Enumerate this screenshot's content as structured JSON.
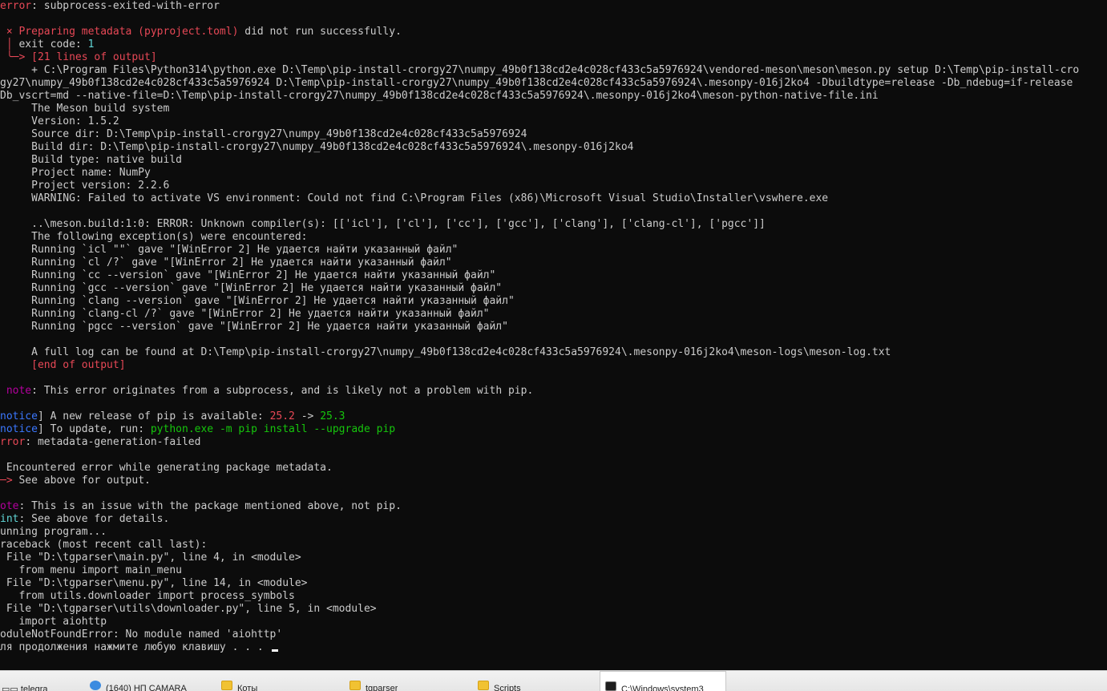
{
  "terminal": {
    "lines": [
      [
        {
          "t": "error",
          "c": "red"
        },
        {
          "t": ": subprocess-exited-with-error",
          "c": "gray"
        }
      ],
      [],
      [
        {
          "t": " × Preparing metadata (pyproject.toml)",
          "c": "red"
        },
        {
          "t": " did not run successfully.",
          "c": "gray"
        }
      ],
      [
        {
          "t": " │",
          "c": "red"
        },
        {
          "t": " exit code: ",
          "c": "gray"
        },
        {
          "t": "1",
          "c": "cyan"
        }
      ],
      [
        {
          "t": " ╰─> [21 lines of output]",
          "c": "red"
        }
      ],
      [
        {
          "t": "     + C:\\Program Files\\Python314\\python.exe D:\\Temp\\pip-install-crorgy27\\numpy_49b0f138cd2e4c028cf433c5a5976924\\vendored-meson\\meson\\meson.py setup D:\\Temp\\pip-install-cro",
          "c": "gray"
        }
      ],
      [
        {
          "t": "gy27\\numpy_49b0f138cd2e4c028cf433c5a5976924 D:\\Temp\\pip-install-crorgy27\\numpy_49b0f138cd2e4c028cf433c5a5976924\\.mesonpy-016j2ko4 -Dbuildtype=release -Db_ndebug=if-release",
          "c": "gray"
        }
      ],
      [
        {
          "t": "Db_vscrt=md --native-file=D:\\Temp\\pip-install-crorgy27\\numpy_49b0f138cd2e4c028cf433c5a5976924\\.mesonpy-016j2ko4\\meson-python-native-file.ini",
          "c": "gray"
        }
      ],
      [
        {
          "t": "     The Meson build system",
          "c": "gray"
        }
      ],
      [
        {
          "t": "     Version: 1.5.2",
          "c": "gray"
        }
      ],
      [
        {
          "t": "     Source dir: D:\\Temp\\pip-install-crorgy27\\numpy_49b0f138cd2e4c028cf433c5a5976924",
          "c": "gray"
        }
      ],
      [
        {
          "t": "     Build dir: D:\\Temp\\pip-install-crorgy27\\numpy_49b0f138cd2e4c028cf433c5a5976924\\.mesonpy-016j2ko4",
          "c": "gray"
        }
      ],
      [
        {
          "t": "     Build type: native build",
          "c": "gray"
        }
      ],
      [
        {
          "t": "     Project name: NumPy",
          "c": "gray"
        }
      ],
      [
        {
          "t": "     Project version: 2.2.6",
          "c": "gray"
        }
      ],
      [
        {
          "t": "     WARNING: Failed to activate VS environment: Could not find C:\\Program Files (x86)\\Microsoft Visual Studio\\Installer\\vswhere.exe",
          "c": "gray"
        }
      ],
      [],
      [
        {
          "t": "     ..\\meson.build:1:0: ERROR: Unknown compiler(s): [['icl'], ['cl'], ['cc'], ['gcc'], ['clang'], ['clang-cl'], ['pgcc']]",
          "c": "gray"
        }
      ],
      [
        {
          "t": "     The following exception(s) were encountered:",
          "c": "gray"
        }
      ],
      [
        {
          "t": "     Running `icl \"\"` gave \"[WinError 2] Не удается найти указанный файл\"",
          "c": "gray"
        }
      ],
      [
        {
          "t": "     Running `cl /?` gave \"[WinError 2] Не удается найти указанный файл\"",
          "c": "gray"
        }
      ],
      [
        {
          "t": "     Running `cc --version` gave \"[WinError 2] Не удается найти указанный файл\"",
          "c": "gray"
        }
      ],
      [
        {
          "t": "     Running `gcc --version` gave \"[WinError 2] Не удается найти указанный файл\"",
          "c": "gray"
        }
      ],
      [
        {
          "t": "     Running `clang --version` gave \"[WinError 2] Не удается найти указанный файл\"",
          "c": "gray"
        }
      ],
      [
        {
          "t": "     Running `clang-cl /?` gave \"[WinError 2] Не удается найти указанный файл\"",
          "c": "gray"
        }
      ],
      [
        {
          "t": "     Running `pgcc --version` gave \"[WinError 2] Не удается найти указанный файл\"",
          "c": "gray"
        }
      ],
      [],
      [
        {
          "t": "     A full log can be found at D:\\Temp\\pip-install-crorgy27\\numpy_49b0f138cd2e4c028cf433c5a5976924\\.mesonpy-016j2ko4\\meson-logs\\meson-log.txt",
          "c": "gray"
        }
      ],
      [
        {
          "t": "     [end of output]",
          "c": "red"
        }
      ],
      [],
      [
        {
          "t": " note",
          "c": "magenta"
        },
        {
          "t": ": This error originates from a subprocess, and is likely not a problem with pip.",
          "c": "gray"
        }
      ],
      [],
      [
        {
          "t": "notice",
          "c": "blue"
        },
        {
          "t": "] A new release of pip is available: ",
          "c": "gray"
        },
        {
          "t": "25.2",
          "c": "red"
        },
        {
          "t": " -> ",
          "c": "gray"
        },
        {
          "t": "25.3",
          "c": "green"
        }
      ],
      [
        {
          "t": "notice",
          "c": "blue"
        },
        {
          "t": "] To update, run: ",
          "c": "gray"
        },
        {
          "t": "python.exe -m pip install --upgrade pip",
          "c": "green"
        }
      ],
      [
        {
          "t": "rror",
          "c": "red"
        },
        {
          "t": ": metadata-generation-failed",
          "c": "gray"
        }
      ],
      [],
      [
        {
          "t": " Encountered error while generating package metadata.",
          "c": "gray"
        }
      ],
      [
        {
          "t": "─>",
          "c": "red"
        },
        {
          "t": " See above for output.",
          "c": "gray"
        }
      ],
      [],
      [
        {
          "t": "ote",
          "c": "magenta"
        },
        {
          "t": ": This is an issue with the package mentioned above, not pip.",
          "c": "gray"
        }
      ],
      [
        {
          "t": "int",
          "c": "cyan"
        },
        {
          "t": ": See above for details.",
          "c": "gray"
        }
      ],
      [
        {
          "t": "unning program...",
          "c": "gray"
        }
      ],
      [
        {
          "t": "raceback (most recent call last):",
          "c": "gray"
        }
      ],
      [
        {
          "t": " File \"D:\\tgparser\\main.py\", line 4, in <module>",
          "c": "gray"
        }
      ],
      [
        {
          "t": "   from menu import main_menu",
          "c": "gray"
        }
      ],
      [
        {
          "t": " File \"D:\\tgparser\\menu.py\", line 14, in <module>",
          "c": "gray"
        }
      ],
      [
        {
          "t": "   from utils.downloader import process_symbols",
          "c": "gray"
        }
      ],
      [
        {
          "t": " File \"D:\\tgparser\\utils\\downloader.py\", line 5, in <module>",
          "c": "gray"
        }
      ],
      [
        {
          "t": "   import aiohttp",
          "c": "gray"
        }
      ],
      [
        {
          "t": "oduleNotFoundError: No module named 'aiohttp'",
          "c": "gray"
        }
      ],
      [
        {
          "t": "ля продолжения нажмите любую клавишу . . . ",
          "c": "gray"
        }
      ]
    ]
  },
  "taskbar": {
    "items": [
      {
        "label": "▭▭ telegra",
        "icon": "telegram-icon",
        "kind": "tg"
      },
      {
        "label": "(1640) HП CAMARA",
        "icon": "browser-icon",
        "kind": "browser"
      },
      {
        "label": "Коты",
        "icon": "folder-icon",
        "kind": "folder"
      },
      {
        "label": "tgparser",
        "icon": "folder-icon",
        "kind": "folder"
      },
      {
        "label": "Scripts",
        "icon": "folder-icon",
        "kind": "folder"
      },
      {
        "label": "C:\\Windows\\system3",
        "icon": "cmd-icon",
        "kind": "cmd",
        "active": true
      }
    ]
  }
}
